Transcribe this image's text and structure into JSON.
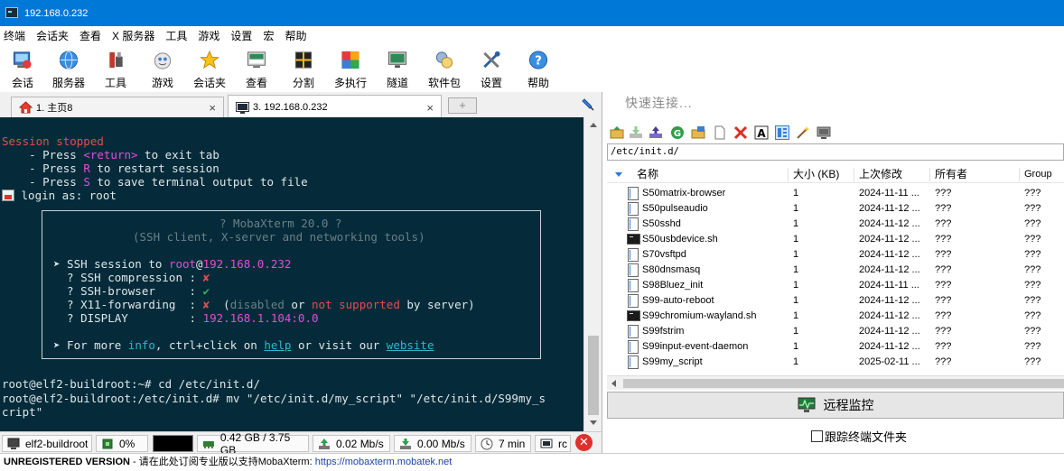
{
  "window": {
    "title": "192.168.0.232"
  },
  "menu": [
    "终端",
    "会话夹",
    "查看",
    "X 服务器",
    "工具",
    "游戏",
    "设置",
    "宏",
    "帮助"
  ],
  "toolbar": [
    {
      "label": "会话",
      "icon": "session-icon"
    },
    {
      "label": "服务器",
      "icon": "servers-icon"
    },
    {
      "label": "工具",
      "icon": "tools-icon"
    },
    {
      "label": "游戏",
      "icon": "games-icon"
    },
    {
      "label": "会话夹",
      "icon": "sessions-star-icon"
    },
    {
      "label": "查看",
      "icon": "view-icon"
    },
    {
      "label": "分割",
      "icon": "split-icon"
    },
    {
      "label": "多执行",
      "icon": "multiexec-icon"
    },
    {
      "label": "隧道",
      "icon": "tunneling-icon"
    },
    {
      "label": "软件包",
      "icon": "packages-icon"
    },
    {
      "label": "设置",
      "icon": "settings-icon"
    },
    {
      "label": "帮助",
      "icon": "help-icon"
    }
  ],
  "tabs": [
    {
      "label": "1. 主页8",
      "close": "×",
      "icon": "home-icon"
    },
    {
      "label": "3. 192.168.0.232",
      "close": "×",
      "icon": "terminal-icon"
    }
  ],
  "tab_add": "+",
  "terminal": {
    "session_stopped": "Session stopped",
    "line1_a": "    - Press ",
    "line1_b": "<return>",
    "line1_c": " to exit tab",
    "line2_a": "    - Press ",
    "line2_b": "R",
    "line2_c": " to restart session",
    "line3_a": "    - Press ",
    "line3_b": "S",
    "line3_c": " to save terminal output to file",
    "login": " login as: root",
    "banner": {
      "title": "? MobaXterm 20.0 ?",
      "subtitle": "(SSH client, X-server and networking tools)",
      "ssh_a": "➤ SSH session to ",
      "ssh_user": "root",
      "ssh_at": "@",
      "ssh_host": "192.168.0.232",
      "comp_label": "  ? SSH compression : ",
      "comp_val": "✘",
      "browser_label": "  ? SSH-browser     : ",
      "browser_val": "✔",
      "x11_label": "  ? X11-forwarding  : ",
      "x11_val": "✘",
      "x11_open": "  (",
      "x11_disabled": "disabled",
      "x11_or": " or ",
      "x11_notsup": "not supported",
      "x11_end": " by server)",
      "display_label": "  ? DISPLAY         : ",
      "display_val": "192.168.1.104:0.0",
      "more_a": "➤ For more ",
      "more_info": "info",
      "more_b": ", ctrl+click on ",
      "more_help": "help",
      "more_c": " or visit our ",
      "more_web": "website"
    },
    "cmd1": "root@elf2-buildroot:~# cd /etc/init.d/",
    "cmd2": "root@elf2-buildroot:/etc/init.d# mv \"/etc/init.d/my_script\" \"/etc/init.d/S99my_s",
    "cmd3": "cript\""
  },
  "statusbar": {
    "host": "elf2-buildroot",
    "cpu": "0%",
    "mem": "0.42 GB / 3.75 GB",
    "up": "0.02 Mb/s",
    "down": "0.00 Mb/s",
    "uptime": "7 min",
    "user": "rc",
    "close": "✕"
  },
  "unregistered": {
    "bold": "UNREGISTERED VERSION",
    "text": "  -  请在此处订阅专业版以支持MobaXterm:  ",
    "link": "https://mobaxterm.mobatek.net"
  },
  "right_panel": {
    "quick_connect_placeholder": "快速连接...",
    "path": "/etc/init.d/",
    "columns": {
      "name": "名称",
      "size": "大小 (KB)",
      "modified": "上次修改",
      "owner": "所有者",
      "group": "Group"
    },
    "files": [
      {
        "name": "S50matrix-browser",
        "size": "1",
        "modified": "2024-11-11 ...",
        "owner": "???",
        "group": "???",
        "type": "file"
      },
      {
        "name": "S50pulseaudio",
        "size": "1",
        "modified": "2024-11-12 ...",
        "owner": "???",
        "group": "???",
        "type": "file"
      },
      {
        "name": "S50sshd",
        "size": "1",
        "modified": "2024-11-12 ...",
        "owner": "???",
        "group": "???",
        "type": "file"
      },
      {
        "name": "S50usbdevice.sh",
        "size": "1",
        "modified": "2024-11-12 ...",
        "owner": "???",
        "group": "???",
        "type": "sh"
      },
      {
        "name": "S70vsftpd",
        "size": "1",
        "modified": "2024-11-12 ...",
        "owner": "???",
        "group": "???",
        "type": "file"
      },
      {
        "name": "S80dnsmasq",
        "size": "1",
        "modified": "2024-11-12 ...",
        "owner": "???",
        "group": "???",
        "type": "file"
      },
      {
        "name": "S98Bluez_init",
        "size": "1",
        "modified": "2024-11-11 ...",
        "owner": "???",
        "group": "???",
        "type": "file"
      },
      {
        "name": "S99-auto-reboot",
        "size": "1",
        "modified": "2024-11-12 ...",
        "owner": "???",
        "group": "???",
        "type": "file"
      },
      {
        "name": "S99chromium-wayland.sh",
        "size": "1",
        "modified": "2024-11-12 ...",
        "owner": "???",
        "group": "???",
        "type": "sh"
      },
      {
        "name": "S99fstrim",
        "size": "1",
        "modified": "2024-11-12 ...",
        "owner": "???",
        "group": "???",
        "type": "file"
      },
      {
        "name": "S99input-event-daemon",
        "size": "1",
        "modified": "2024-11-12 ...",
        "owner": "???",
        "group": "???",
        "type": "file"
      },
      {
        "name": "S99my_script",
        "size": "1",
        "modified": "2025-02-11 ...",
        "owner": "???",
        "group": "???",
        "type": "file"
      }
    ],
    "monitor_label": "远程监控",
    "follow_label": "跟踪终端文件夹"
  }
}
